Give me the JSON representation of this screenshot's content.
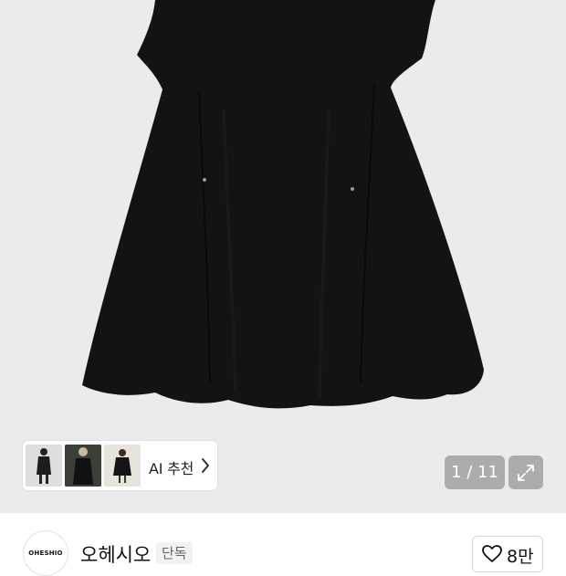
{
  "gallery": {
    "page_counter": "1 / 11",
    "ai_recommend_label": "AI 추천",
    "thumbnails": [
      "outfit-thumb-1",
      "outfit-thumb-2",
      "outfit-thumb-3"
    ],
    "icons": {
      "expand": "expand-icon",
      "chevron": "chevron-right-icon"
    }
  },
  "brand": {
    "logo_text": "OHESHIO",
    "name": "오헤시오",
    "badge": "단독",
    "likes": "8만",
    "icons": {
      "like": "heart-icon"
    }
  },
  "colors": {
    "image_background": "#ebebeb",
    "dress": "#121212",
    "overlay_button": "#787878"
  }
}
